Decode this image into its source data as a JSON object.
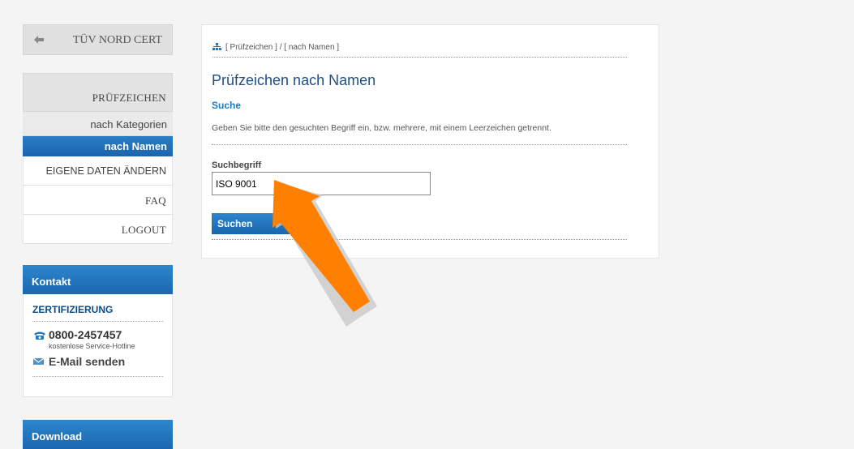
{
  "sidebar": {
    "back_label": "TÜV NORD CERT",
    "menu_head": "PRÜFZEICHEN",
    "items": [
      {
        "label": "nach Kategorien"
      },
      {
        "label": "nach Namen"
      },
      {
        "label": "EIGENE DATEN ÄNDERN"
      },
      {
        "label": "FAQ"
      },
      {
        "label": "LOGOUT"
      }
    ]
  },
  "kontakt": {
    "header": "Kontakt",
    "title": "ZERTIFIZIERUNG",
    "phone": "0800-2457457",
    "hotline": "kostenlose Service-Hotline",
    "mail": "E-Mail senden"
  },
  "download": {
    "header": "Download"
  },
  "main": {
    "breadcrumb": "[ Prüfzeichen ]  /  [ nach Namen ]",
    "title": "Prüfzeichen nach Namen",
    "section": "Suche",
    "hint": "Geben Sie bitte den gesuchten Begriff ein, bzw. mehrere, mit einem Leerzeichen getrennt.",
    "field_label": "Suchbegriff",
    "search_value": "ISO 9001",
    "button": "Suchen"
  },
  "colors": {
    "accent_blue": "#1b68b0",
    "title_blue": "#1d4f86",
    "arrow_orange": "#ff7f00"
  },
  "icons": [
    "back-arrow-icon",
    "sitemap-icon",
    "phone-icon",
    "mail-icon"
  ]
}
